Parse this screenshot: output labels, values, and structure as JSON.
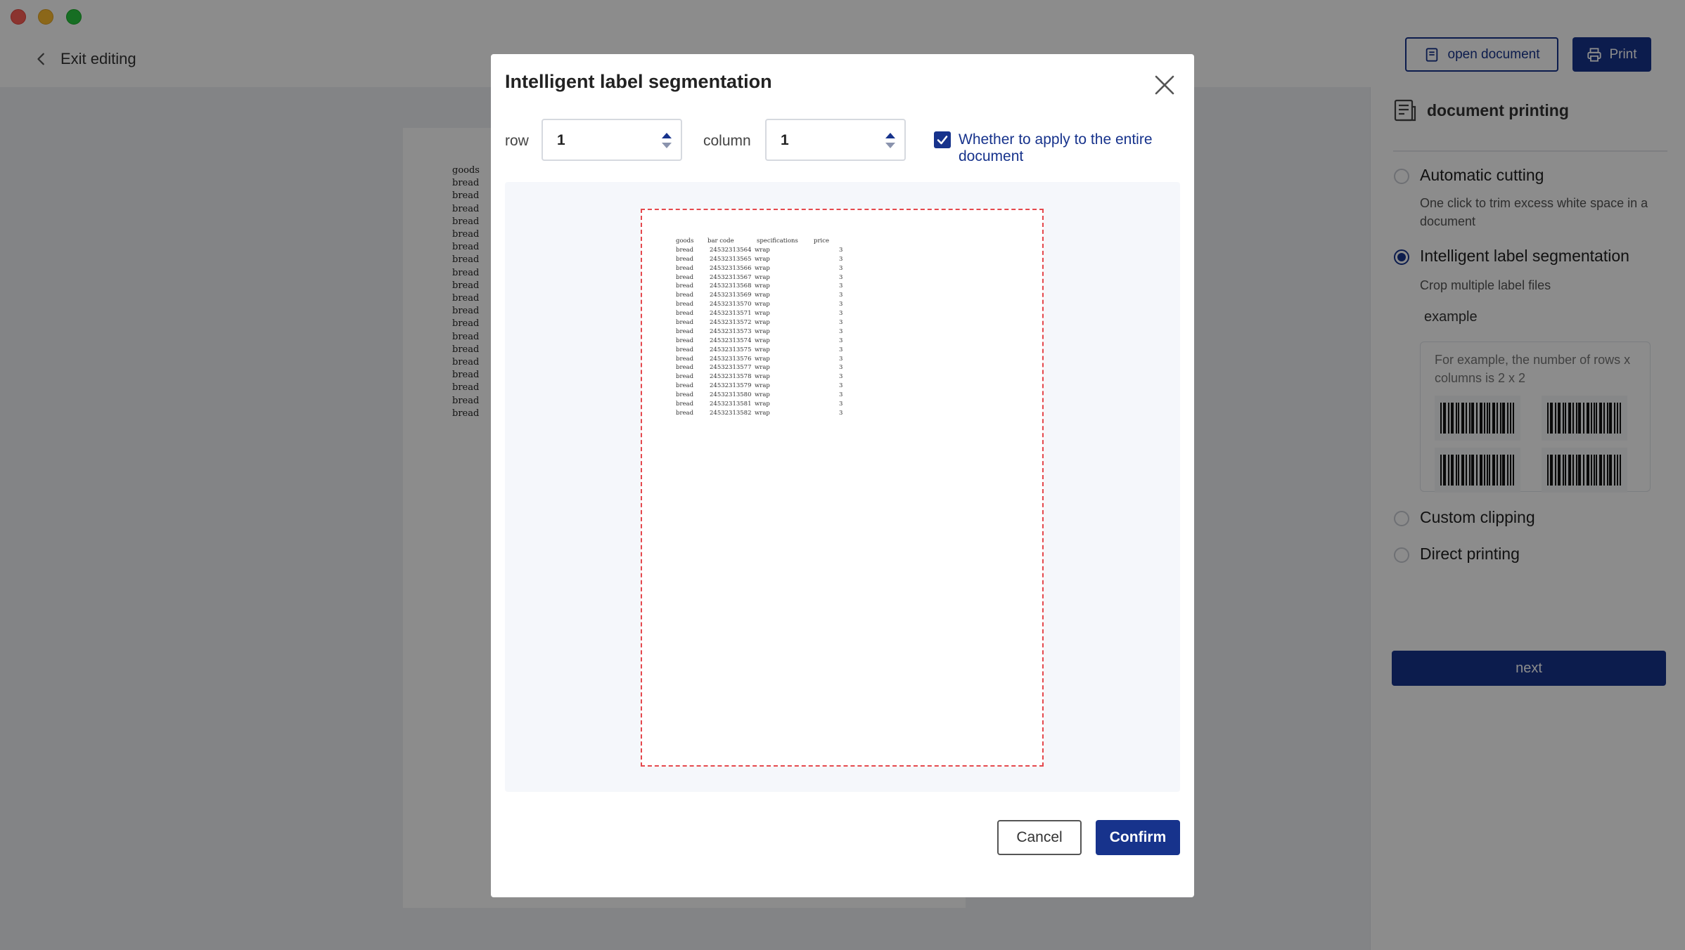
{
  "toolbar": {
    "exit_label": "Exit editing",
    "open_document_label": "open document",
    "print_label": "Print"
  },
  "document": {
    "first_column": [
      "goods",
      "bread",
      "bread",
      "bread",
      "bread",
      "bread",
      "bread",
      "bread",
      "bread",
      "bread",
      "bread",
      "bread",
      "bread",
      "bread",
      "bread",
      "bread",
      "bread",
      "bread",
      "bread",
      "bread"
    ]
  },
  "panel": {
    "title": "document printing",
    "options": [
      {
        "label": "Automatic cutting",
        "description": "One click to trim excess white space in a document",
        "selected": false
      },
      {
        "label": "Intelligent label segmentation",
        "description": "Crop multiple label files",
        "selected": true
      },
      {
        "label": "Custom clipping",
        "selected": false
      },
      {
        "label": "Direct printing",
        "selected": false
      }
    ],
    "example_label": "example",
    "example_text": "For example, the number of rows x columns is 2 x 2",
    "next_label": "next"
  },
  "modal": {
    "title": "Intelligent label segmentation",
    "row_label": "row",
    "row_value": "1",
    "column_label": "column",
    "column_value": "1",
    "apply_all_label": "Whether to apply to the entire document",
    "apply_all_checked": true,
    "cancel_label": "Cancel",
    "confirm_label": "Confirm",
    "preview": {
      "headers": [
        "goods",
        "bar code",
        "specifications",
        "price"
      ],
      "rows": [
        [
          "bread",
          "24532313564",
          "wrap",
          "3"
        ],
        [
          "bread",
          "24532313565",
          "wrap",
          "3"
        ],
        [
          "bread",
          "24532313566",
          "wrap",
          "3"
        ],
        [
          "bread",
          "24532313567",
          "wrap",
          "3"
        ],
        [
          "bread",
          "24532313568",
          "wrap",
          "3"
        ],
        [
          "bread",
          "24532313569",
          "wrap",
          "3"
        ],
        [
          "bread",
          "24532313570",
          "wrap",
          "3"
        ],
        [
          "bread",
          "24532313571",
          "wrap",
          "3"
        ],
        [
          "bread",
          "24532313572",
          "wrap",
          "3"
        ],
        [
          "bread",
          "24532313573",
          "wrap",
          "3"
        ],
        [
          "bread",
          "24532313574",
          "wrap",
          "3"
        ],
        [
          "bread",
          "24532313575",
          "wrap",
          "3"
        ],
        [
          "bread",
          "24532313576",
          "wrap",
          "3"
        ],
        [
          "bread",
          "24532313577",
          "wrap",
          "3"
        ],
        [
          "bread",
          "24532313578",
          "wrap",
          "3"
        ],
        [
          "bread",
          "24532313579",
          "wrap",
          "3"
        ],
        [
          "bread",
          "24532313580",
          "wrap",
          "3"
        ],
        [
          "bread",
          "24532313581",
          "wrap",
          "3"
        ],
        [
          "bread",
          "24532313582",
          "wrap",
          "3"
        ]
      ]
    }
  },
  "colors": {
    "primary": "#17338c",
    "dashed_border": "#e5484d"
  }
}
